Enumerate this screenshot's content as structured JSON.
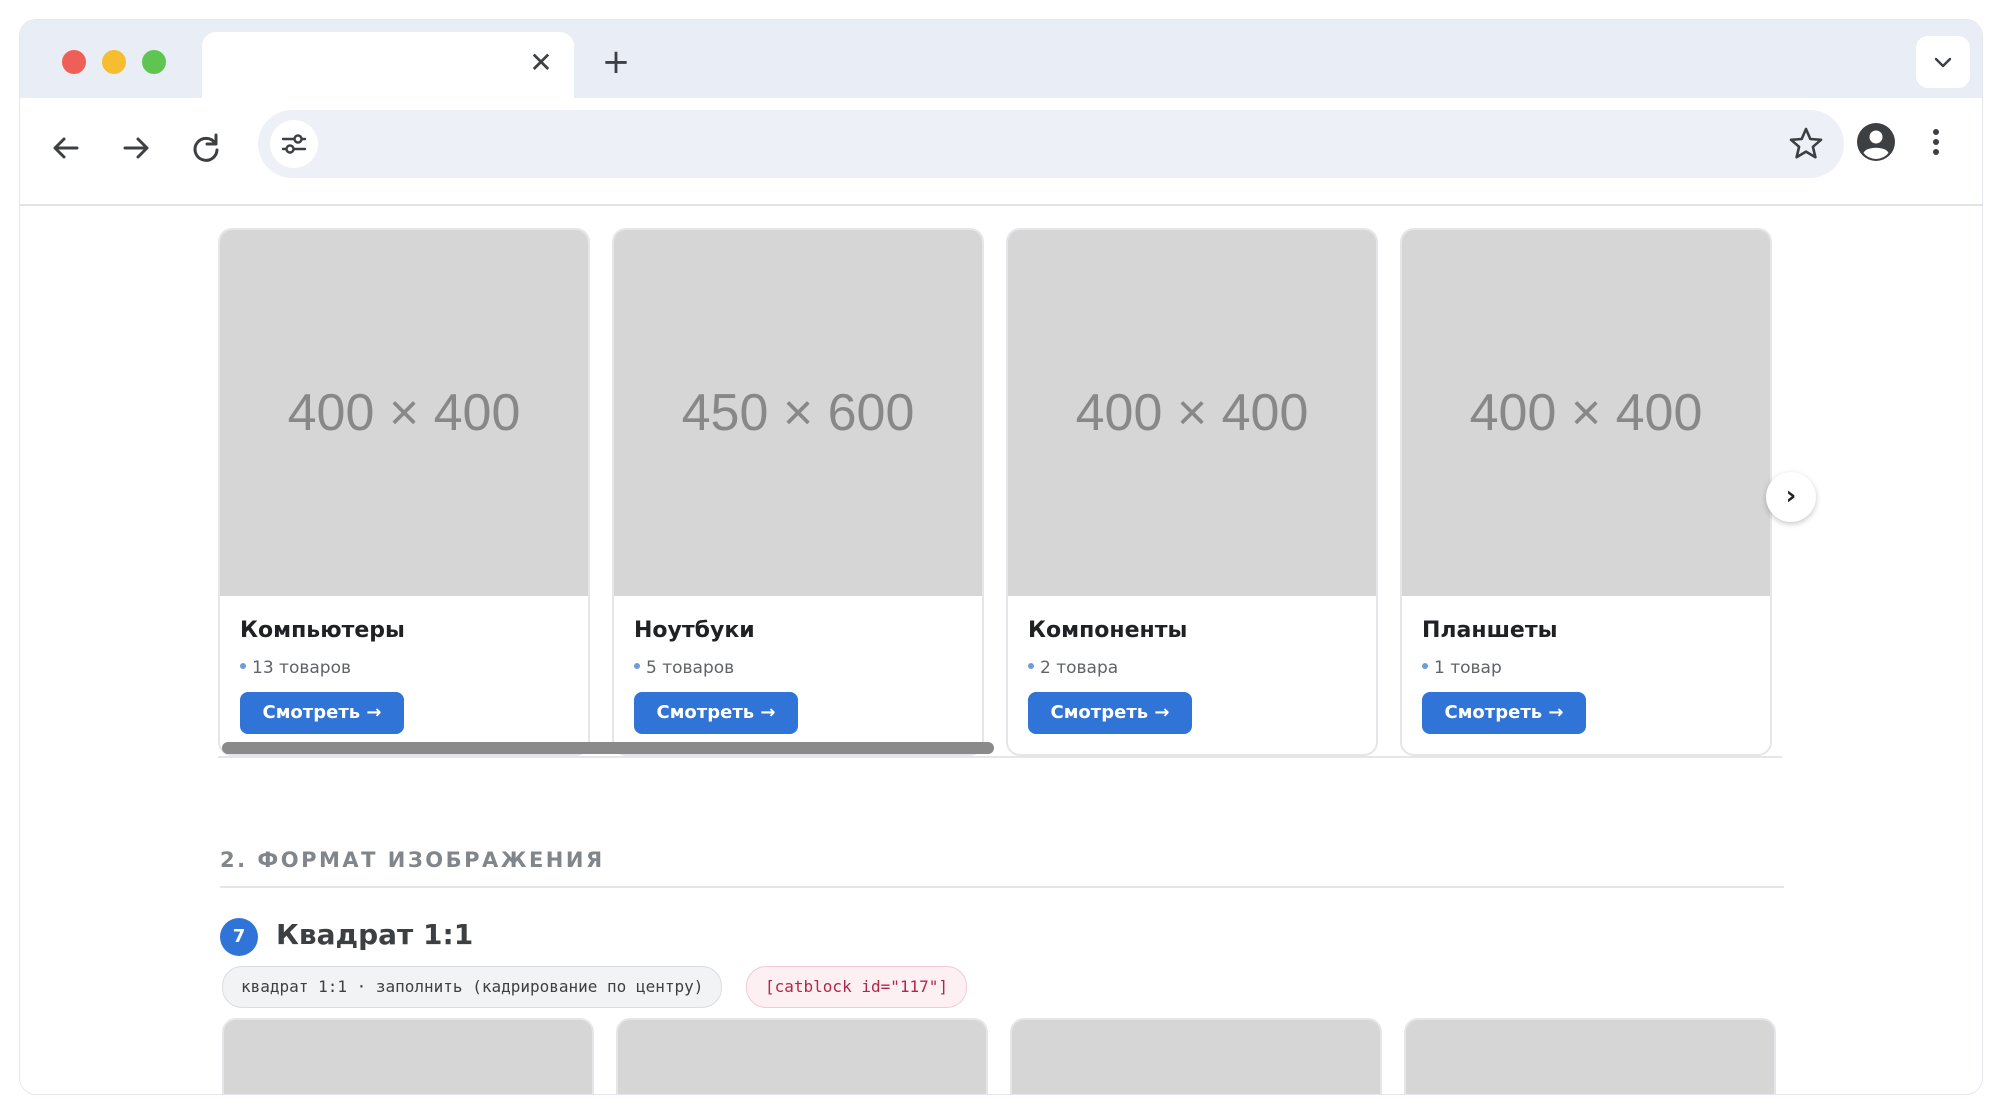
{
  "browser": {
    "tab_close_glyph": "✕",
    "new_tab_glyph": "+",
    "icons": [
      "back-arrow-icon",
      "forward-arrow-icon",
      "reload-icon",
      "site-settings-icon",
      "bookmark-star-icon",
      "account-icon",
      "more-vert-icon",
      "chevron-down-icon"
    ]
  },
  "carousel": {
    "next_glyph": "›",
    "cards": [
      {
        "image_label": "400 × 400",
        "title": "Компьютеры",
        "count": "13 товаров",
        "button": "Смотреть →"
      },
      {
        "image_label": "450 × 600",
        "title": "Ноутбуки",
        "count": "5 товаров",
        "button": "Смотреть →"
      },
      {
        "image_label": "400 × 400",
        "title": "Компоненты",
        "count": "2 товара",
        "button": "Смотреть →"
      },
      {
        "image_label": "400 × 400",
        "title": "Планшеты",
        "count": "1 товар",
        "button": "Смотреть →"
      }
    ]
  },
  "section": {
    "heading": "2. ФОРМАТ ИЗОБРАЖЕНИЯ",
    "badge_number": "7",
    "title": "Квадрат 1:1",
    "mode_chip": "квадрат 1:1 · заполнить (кадрирование по центру)",
    "code_chip": "[catblock id=\"117\"]"
  },
  "colors": {
    "accent": "#2f74d6",
    "placeholder_bg": "#d6d6d6",
    "code_text": "#b3264a"
  }
}
